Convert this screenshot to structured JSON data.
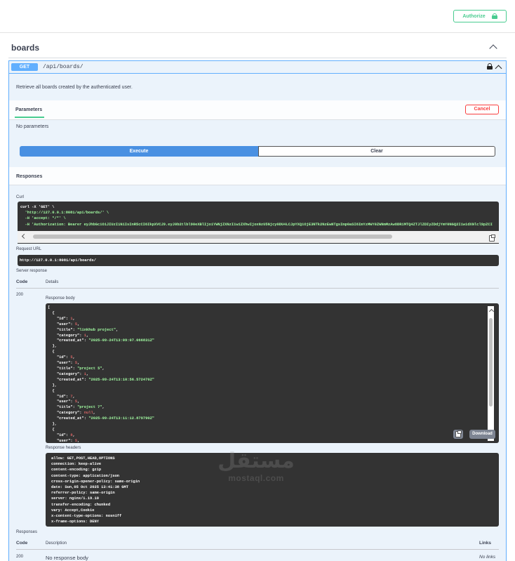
{
  "topbar": {
    "authorize_label": "Authorize"
  },
  "tag": {
    "name": "boards"
  },
  "operation": {
    "method": "GET",
    "path": "/api/boards/",
    "description": "Retrieve all boards created by the authenticated user.",
    "parameters_tab": "Parameters",
    "cancel_label": "Cancel",
    "no_parameters": "No parameters",
    "execute_label": "Execute",
    "clear_label": "Clear",
    "responses_title": "Responses"
  },
  "curl": {
    "label": "Curl",
    "lines": [
      "curl -X 'GET' \\",
      "  'http://127.0.0.1:8081/api/boards/' \\",
      "  -H 'accept: */*' \\",
      "  -H 'Authorization: Bearer eyJhbGciOiJIUzI1NiIsInR5cCI6IkpXVCJ9.eyJ0b2tlbl90eXBlIjoiYWNjZXNzIiwiZXhwIjoxNzU5Njcy0DU4LCJpYXQiOjE3NTk2NzEwNTgsImp0aSI6ImYzMWY0ZWNmMzAwODRiMTQ4ZTJlZDIyZDdjYmY0NGQ2IiwidXNlcl9pZCI"
    ]
  },
  "request_url": {
    "label": "Request URL",
    "value": "http://127.0.0.1:8081/api/boards/"
  },
  "server_response": {
    "label": "Server response",
    "code_header": "Code",
    "details_header": "Details",
    "code": "200",
    "body_label": "Response body",
    "body_lines": [
      "[",
      "  {",
      "    \"id\": 1,",
      "    \"user\": 5,",
      "    \"title\": \"linkhub project\",",
      "    \"category\": 1,",
      "    \"created_at\": \"2025-09-24T13:09:07.066831Z\"",
      "  },",
      "  {",
      "    \"id\": 5,",
      "    \"user\": 5,",
      "    \"title\": \"project 5\",",
      "    \"category\": 1,",
      "    \"created_at\": \"2025-09-24T13:10:56.572470Z\"",
      "  },",
      "  {",
      "    \"id\": 7,",
      "    \"user\": 5,",
      "    \"title\": \"project 7\",",
      "    \"category\": null,",
      "    \"created_at\": \"2025-09-24T13:11:12.879790Z\"",
      "  },",
      "  {",
      "    \"id\": 8,",
      "    \"user\": 5,"
    ],
    "download_label": "Download",
    "headers_label": "Response headers",
    "headers_lines": [
      "allow: GET,POST,HEAD,OPTIONS",
      "connection: keep-alive",
      "content-encoding: gzip",
      "content-type: application/json",
      "cross-origin-opener-policy: same-origin",
      "date: Sun,05 Oct 2025 13:41:38 GMT",
      "referrer-policy: same-origin",
      "server: nginx/1.19.10",
      "transfer-encoding: chunked",
      "vary: Accept,Cookie",
      "x-content-type-options: nosniff",
      "x-frame-options: DENY"
    ]
  },
  "responses": {
    "label": "Responses",
    "code_header": "Code",
    "description_header": "Description",
    "links_header": "Links",
    "rows": [
      {
        "code": "200",
        "description": "No response body",
        "links": "No links"
      }
    ]
  },
  "watermark": {
    "arabic": "مستقل",
    "latin": "mostaql.com"
  }
}
